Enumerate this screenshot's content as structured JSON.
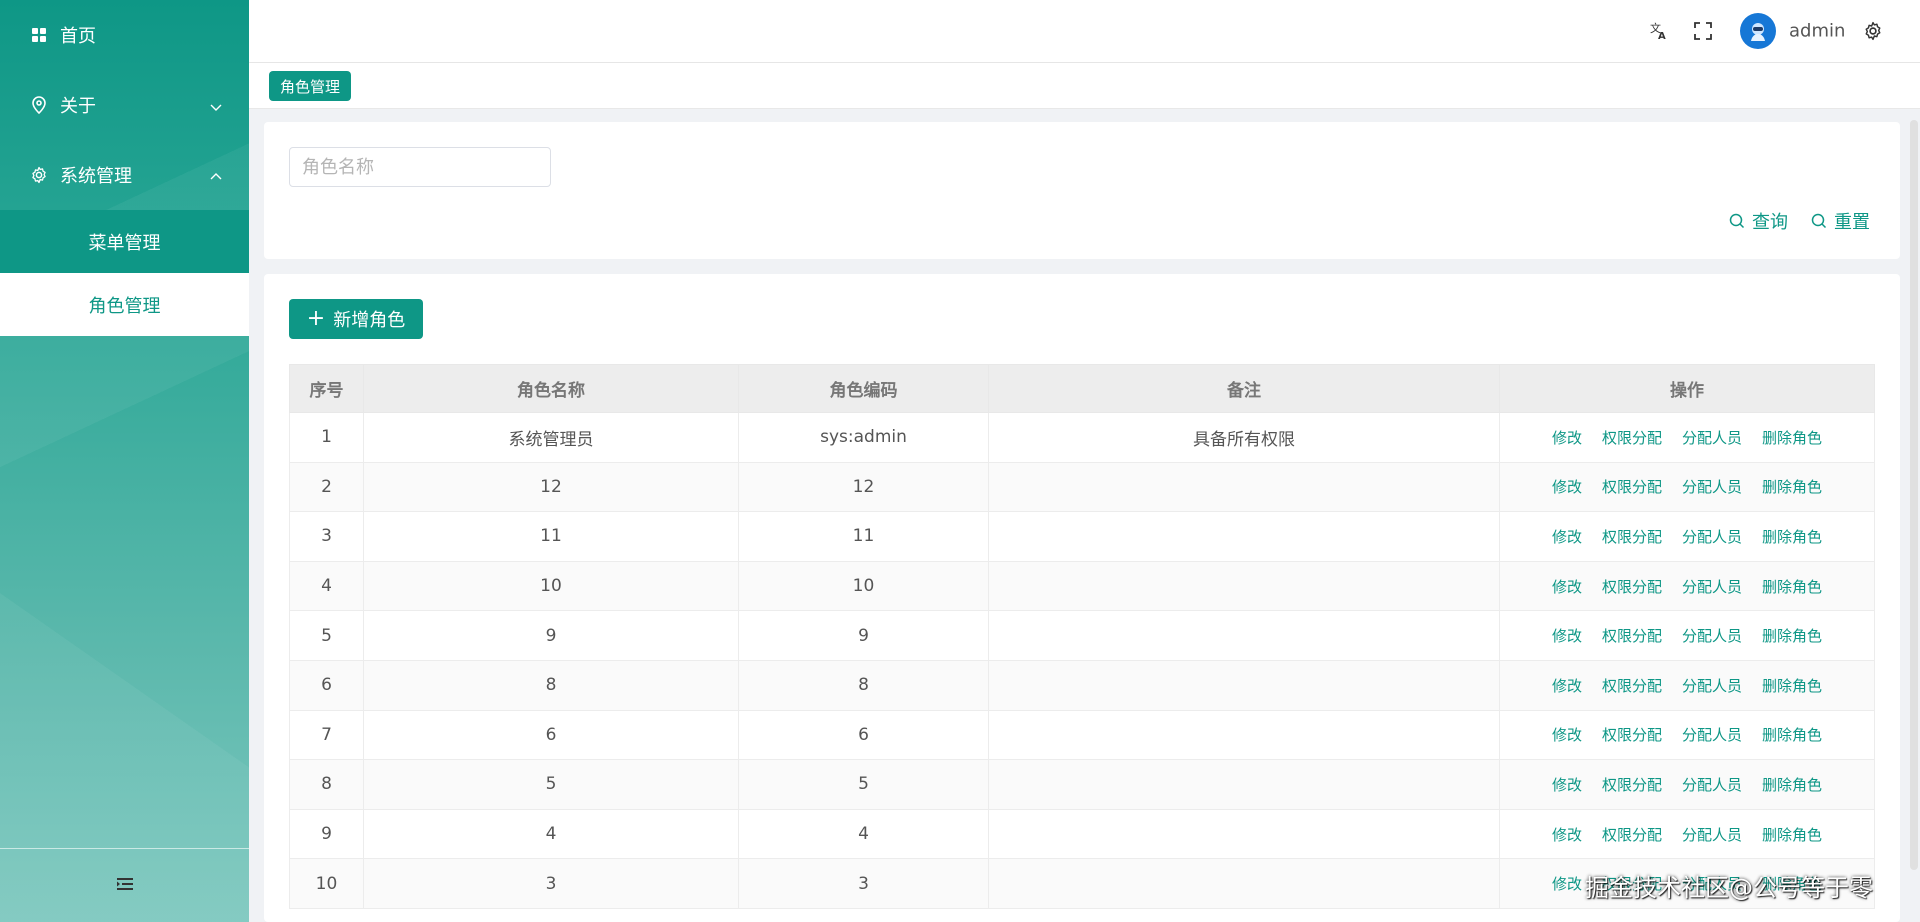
{
  "sidebar": {
    "items": [
      {
        "label": "首页",
        "icon": "grid-icon"
      },
      {
        "label": "关于",
        "icon": "location-icon"
      },
      {
        "label": "系统管理",
        "icon": "gear-icon"
      }
    ],
    "sub_items": [
      {
        "label": "菜单管理"
      },
      {
        "label": "角色管理"
      }
    ],
    "collapse_icon": "menu-fold-icon"
  },
  "header": {
    "user_name": "admin",
    "icons": [
      "translate-icon",
      "fullscreen-icon",
      "avatar",
      "settings-icon"
    ]
  },
  "tags": {
    "active_tag": "角色管理"
  },
  "search": {
    "role_name_placeholder": "角色名称",
    "query_label": "查询",
    "reset_label": "重置"
  },
  "toolbar": {
    "add_role_label": "新增角色"
  },
  "table": {
    "headers": [
      "序号",
      "角色名称",
      "角色编码",
      "备注",
      "操作"
    ],
    "rows": [
      {
        "index": "1",
        "name": "系统管理员",
        "code": "sys:admin",
        "remark": "具备所有权限"
      },
      {
        "index": "2",
        "name": "12",
        "code": "12",
        "remark": ""
      },
      {
        "index": "3",
        "name": "11",
        "code": "11",
        "remark": ""
      },
      {
        "index": "4",
        "name": "10",
        "code": "10",
        "remark": ""
      },
      {
        "index": "5",
        "name": "9",
        "code": "9",
        "remark": ""
      },
      {
        "index": "6",
        "name": "8",
        "code": "8",
        "remark": ""
      },
      {
        "index": "7",
        "name": "6",
        "code": "6",
        "remark": ""
      },
      {
        "index": "8",
        "name": "5",
        "code": "5",
        "remark": ""
      },
      {
        "index": "9",
        "name": "4",
        "code": "4",
        "remark": ""
      },
      {
        "index": "10",
        "name": "3",
        "code": "3",
        "remark": ""
      }
    ],
    "actions": [
      "修改",
      "权限分配",
      "分配人员",
      "删除角色"
    ]
  },
  "watermark": "掘金技术社区@公号等于零",
  "colors": {
    "primary": "#0e9786",
    "sidebar_gradient_end": "#7ec8bf",
    "avatar_bg": "#1677d6"
  }
}
